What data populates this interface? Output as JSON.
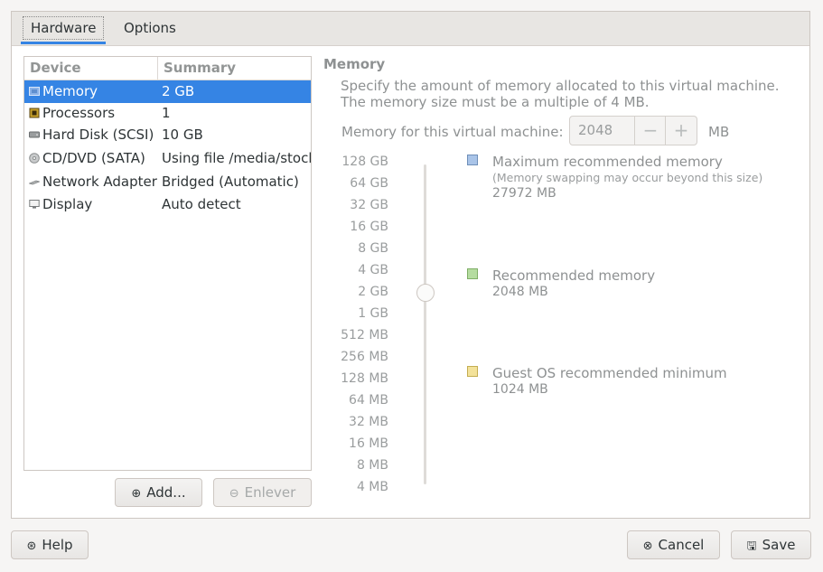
{
  "tabs": [
    {
      "label": "Hardware",
      "active": true
    },
    {
      "label": "Options",
      "active": false
    }
  ],
  "device_list": {
    "columns": [
      "Device",
      "Summary"
    ],
    "rows": [
      {
        "device": "Memory",
        "summary": "2 GB",
        "icon": "memory-icon",
        "selected": true
      },
      {
        "device": "Processors",
        "summary": "1",
        "icon": "processor-icon"
      },
      {
        "device": "Hard Disk (SCSI)",
        "summary": "10 GB",
        "icon": "hard-disk-icon"
      },
      {
        "device": "CD/DVD (SATA)",
        "summary": "Using file /media/stock",
        "icon": "cd-dvd-icon"
      },
      {
        "device": "Network Adapter",
        "summary": "Bridged (Automatic)",
        "icon": "network-adapter-icon"
      },
      {
        "device": "Display",
        "summary": "Auto detect",
        "icon": "display-icon"
      }
    ]
  },
  "buttons": {
    "add": "Add...",
    "remove": "Enlever",
    "help": "Help",
    "cancel": "Cancel",
    "save": "Save"
  },
  "memory": {
    "title": "Memory",
    "description": "Specify the amount of memory allocated to this virtual machine. The memory size must be a multiple of 4 MB.",
    "field_label": "Memory for this virtual machine:",
    "value": "2048",
    "unit": "MB",
    "ticks": [
      "128 GB",
      "64 GB",
      "32 GB",
      "16 GB",
      "8 GB",
      "4 GB",
      "2 GB",
      "1 GB",
      "512 MB",
      "256 MB",
      "128 MB",
      "64 MB",
      "32 MB",
      "16 MB",
      "8 MB",
      "4 MB"
    ],
    "legend": {
      "max": {
        "title": "Maximum recommended memory",
        "subtitle": "(Memory swapping may occur beyond this size)",
        "value": "27972 MB",
        "color": "#a9c4e8"
      },
      "recommended": {
        "title": "Recommended memory",
        "value": "2048 MB",
        "color": "#b5dca0"
      },
      "minimum": {
        "title": "Guest OS recommended minimum",
        "value": "1024 MB",
        "color": "#f3e29a"
      }
    }
  },
  "colors": {
    "accent": "#3584e4"
  }
}
